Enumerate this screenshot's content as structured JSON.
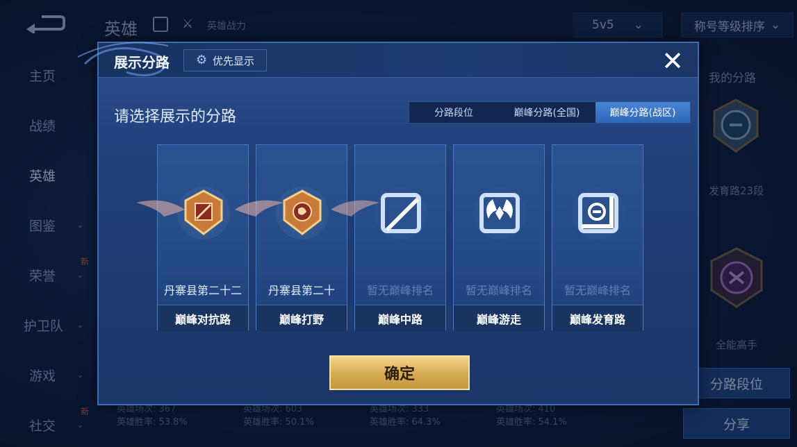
{
  "background": {
    "title": "英雄",
    "power_label": "英雄战力",
    "mode": "5v5",
    "sort": "称号等级排序",
    "nav": [
      {
        "label": "主页",
        "has_chevron": false,
        "badge": ""
      },
      {
        "label": "战绩",
        "has_chevron": false,
        "badge": ""
      },
      {
        "label": "英雄",
        "has_chevron": false,
        "badge": "",
        "active": true
      },
      {
        "label": "图鉴",
        "has_chevron": true,
        "badge": ""
      },
      {
        "label": "荣誉",
        "has_chevron": true,
        "badge": "新"
      },
      {
        "label": "护卫队",
        "has_chevron": true,
        "badge": ""
      },
      {
        "label": "游戏",
        "has_chevron": true,
        "badge": ""
      },
      {
        "label": "社交",
        "has_chevron": true,
        "badge": "新"
      }
    ],
    "side": {
      "title": "我的分路",
      "emblem1_text": "发育路23段",
      "emblem2_text": "全能高手",
      "button1": "分路段位",
      "button2": "分享"
    },
    "stats": [
      {
        "games": "英雄场次: 367",
        "winrate": "英雄胜率: 53.8%"
      },
      {
        "games": "英雄场次: 603",
        "winrate": "英雄胜率: 50.1%"
      },
      {
        "games": "英雄场次: 333",
        "winrate": "英雄胜率: 64.3%"
      },
      {
        "games": "英雄场次: 410",
        "winrate": "英雄胜率: 54.1%"
      }
    ]
  },
  "modal": {
    "title": "展示分路",
    "priority_label": "优先显示",
    "close_glyph": "✕",
    "subtitle": "请选择展示的分路",
    "tabs": [
      {
        "label": "分路段位",
        "active": false
      },
      {
        "label": "巅峰分路(全国)",
        "active": false
      },
      {
        "label": "巅峰分路(战区)",
        "active": true
      }
    ],
    "cards": [
      {
        "name": "丹寨县第二十二",
        "label": "巅峰对抗路",
        "ranked": true,
        "icon": "clash-lane-emblem-icon"
      },
      {
        "name": "丹寨县第二十",
        "label": "巅峰打野",
        "ranked": true,
        "icon": "jungle-emblem-icon"
      },
      {
        "name": "暂无巅峰排名",
        "label": "巅峰中路",
        "ranked": false,
        "icon": "mid-lane-icon"
      },
      {
        "name": "暂无巅峰排名",
        "label": "巅峰游走",
        "ranked": false,
        "icon": "roam-icon"
      },
      {
        "name": "暂无巅峰排名",
        "label": "巅峰发育路",
        "ranked": false,
        "icon": "farm-lane-icon"
      }
    ],
    "confirm": "确定"
  },
  "colors": {
    "accent_gold": "#d7ae57",
    "active_tab": "#3a74c8",
    "card_border": "#4a7ac4"
  }
}
